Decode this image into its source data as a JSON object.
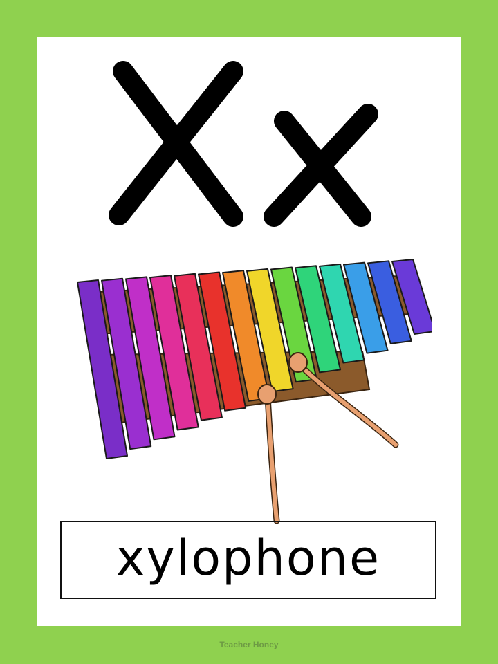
{
  "card": {
    "uppercase_letter": "X",
    "lowercase_letter": "x",
    "word": "xylophone"
  },
  "footer": {
    "credit": "Teacher Honey"
  },
  "colors": {
    "border": "#8fd14f",
    "card_background": "#ffffff",
    "letter": "#000000",
    "frame": "#8b5a2b",
    "mallet": "#e8a070"
  },
  "xylophone": {
    "bar_colors": [
      "#7a2ec8",
      "#9a2fd0",
      "#c02fc8",
      "#e02f9a",
      "#e8305a",
      "#e8322c",
      "#f08a2a",
      "#f0d62a",
      "#6ad640",
      "#2fd47a",
      "#2fd6b0",
      "#3a9ee8",
      "#3a5ee0",
      "#6a3ad8"
    ]
  }
}
